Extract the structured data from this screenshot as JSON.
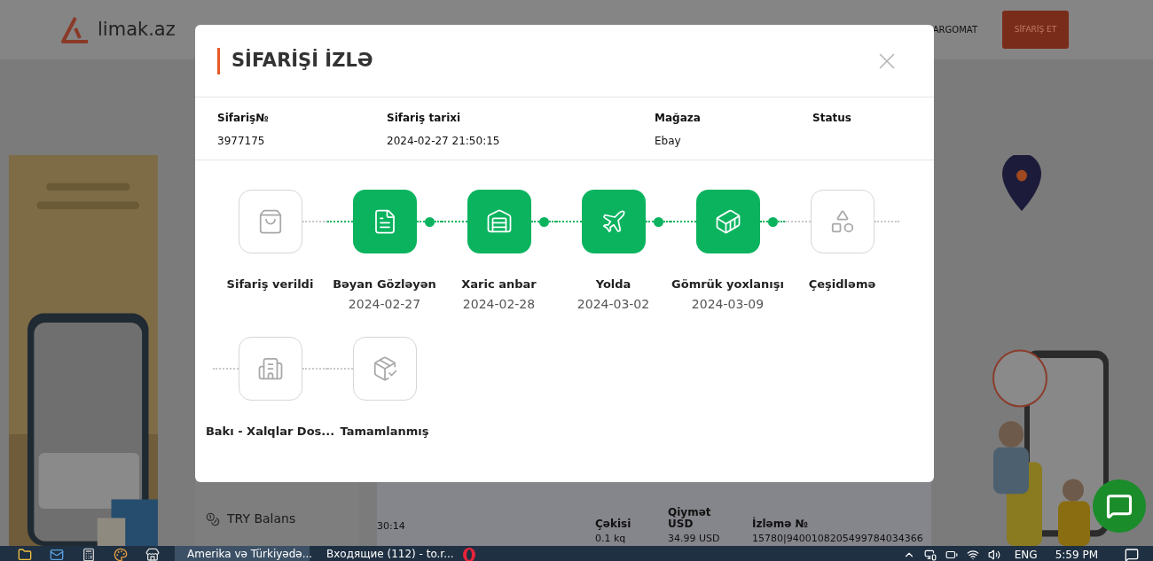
{
  "header": {
    "logo": "limak.az",
    "nav_link": "ARGOMAT",
    "order_button": "SİFARİŞ ET"
  },
  "sidebar": {
    "item": "TRY Balans"
  },
  "table": {
    "first_cell": "30:14",
    "columns": [
      {
        "heading": "Çəkisi",
        "value": "0.1 kq"
      },
      {
        "heading": "Qiymət USD",
        "value": "34.99 USD"
      },
      {
        "heading": "İzləmə №",
        "value": "15780|9400108205499784034366"
      }
    ]
  },
  "modal": {
    "title": "SİFARİŞİ İZLƏ",
    "info": [
      {
        "label": "Sifariş№",
        "value": "3977175"
      },
      {
        "label": "Sifariş tarixi",
        "value": "2024-02-27 21:50:15"
      },
      {
        "label": "Mağaza",
        "value": "Ebay"
      },
      {
        "label": "Status"
      }
    ],
    "steps": [
      {
        "label": "Sifariş verildi",
        "done": false
      },
      {
        "label": "Bəyan Gözləyən",
        "date": "2024-02-27",
        "done": true
      },
      {
        "label": "Xaric anbar",
        "date": "2024-02-28",
        "done": true
      },
      {
        "label": "Yolda",
        "date": "2024-03-02",
        "done": true
      },
      {
        "label": "Gömrük yoxlanışı",
        "date": "2024-03-09",
        "done": true
      },
      {
        "label": "Çeşidləmə",
        "done": false
      },
      {
        "label": "Bakı - Xalqlar Dos...",
        "done": false
      },
      {
        "label": "Tamamlanmış",
        "done": false
      }
    ]
  },
  "taskbar": {
    "windows": [
      {
        "title": "Amerika və Türkiyədə...",
        "selected": true
      },
      {
        "title": "Входящие (112) - to.r...",
        "selected": false
      }
    ],
    "language": "ENG",
    "time": "5:59 PM"
  }
}
